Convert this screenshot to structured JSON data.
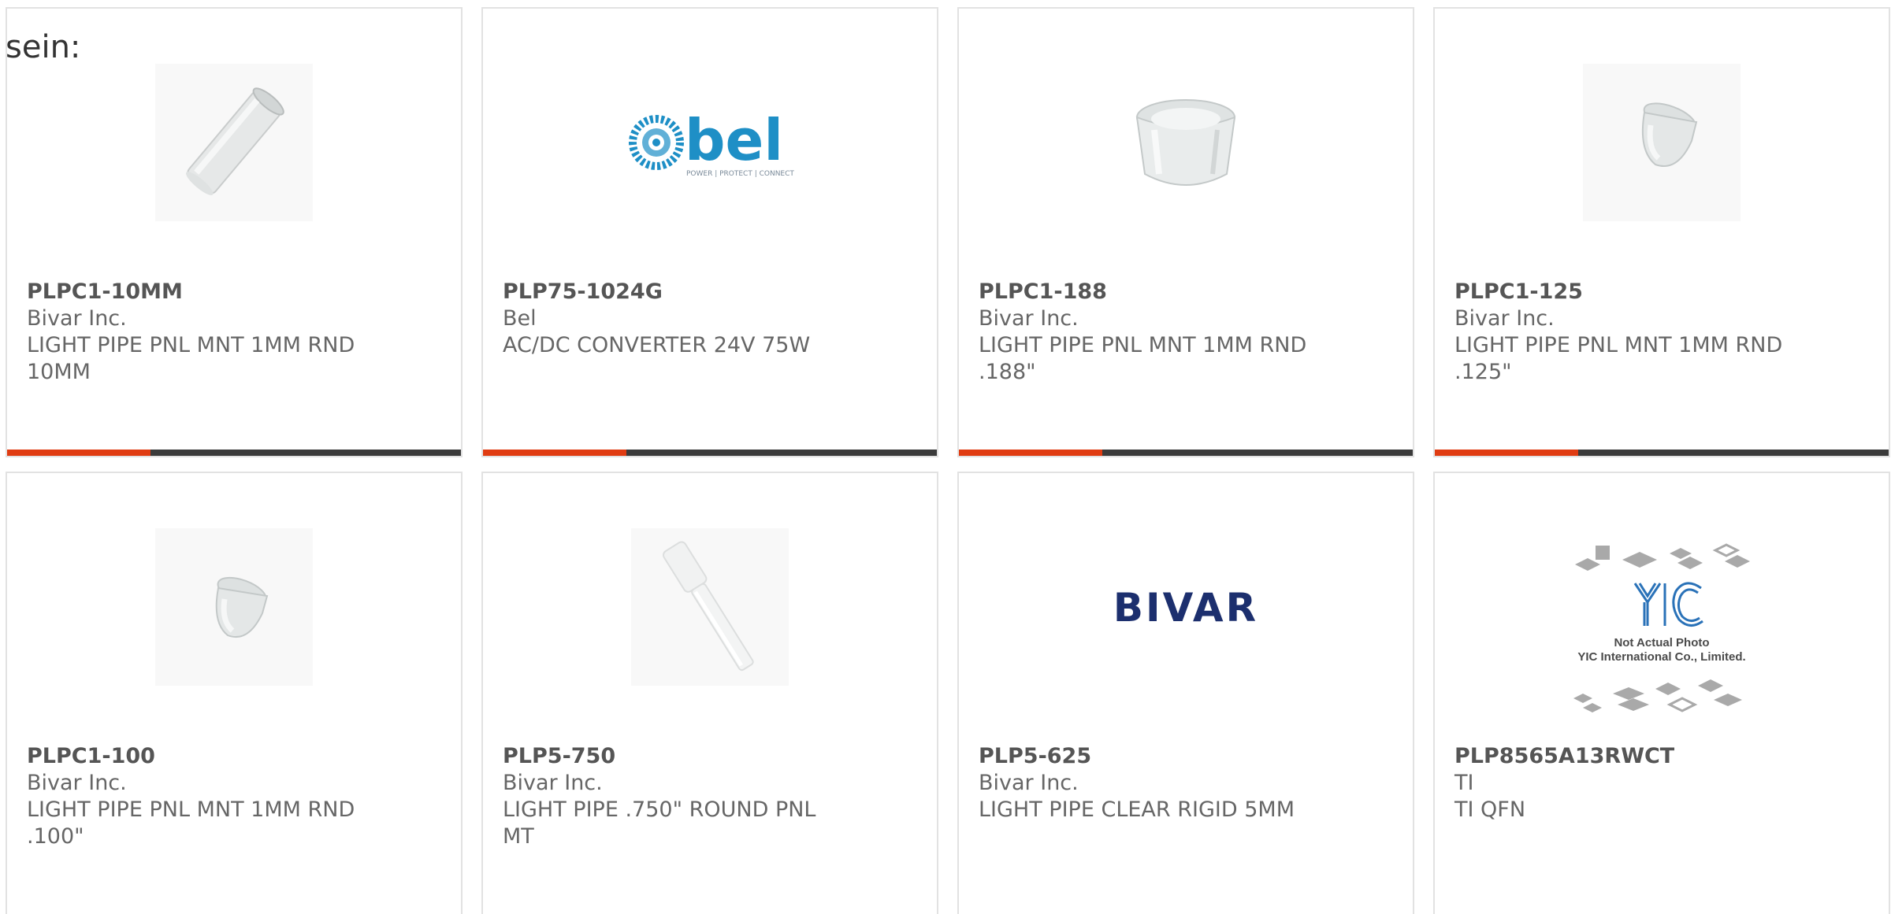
{
  "intro_text": "sein:",
  "colors": {
    "accent": "#e03c12",
    "bar_dark": "#3b3b3b",
    "card_border": "#e2e2e2",
    "bel_blue": "#1e8fc6",
    "bivar_navy": "#1c2f6e"
  },
  "products": [
    {
      "part_number": "PLPC1-10MM",
      "manufacturer": "Bivar Inc.",
      "description": "LIGHT PIPE PNL MNT 1MM RND 10MM",
      "image": "light-pipe-long-icon"
    },
    {
      "part_number": "PLP75-1024G",
      "manufacturer": "Bel",
      "description": "AC/DC CONVERTER 24V 75W",
      "image": "bel-logo",
      "logo": {
        "text": "bel",
        "tagline": "POWER | PROTECT | CONNECT"
      }
    },
    {
      "part_number": "PLPC1-188",
      "manufacturer": "Bivar Inc.",
      "description": "LIGHT PIPE PNL MNT 1MM RND .188\"",
      "image": "light-pipe-wide-icon"
    },
    {
      "part_number": "PLPC1-125",
      "manufacturer": "Bivar Inc.",
      "description": "LIGHT PIPE PNL MNT 1MM RND .125\"",
      "image": "light-pipe-small-icon"
    },
    {
      "part_number": "PLPC1-100",
      "manufacturer": "Bivar Inc.",
      "description": "LIGHT PIPE PNL MNT 1MM RND .100\"",
      "image": "light-pipe-small-icon"
    },
    {
      "part_number": "PLP5-750",
      "manufacturer": "Bivar Inc.",
      "description": "LIGHT PIPE .750\" ROUND PNL MT",
      "image": "light-pipe-rod-icon"
    },
    {
      "part_number": "PLP5-625",
      "manufacturer": "Bivar Inc.",
      "description": "LIGHT PIPE CLEAR RIGID 5MM",
      "image": "bivar-logo",
      "logo": {
        "text": "BIVAR"
      }
    },
    {
      "part_number": "PLP8565A13RWCT",
      "manufacturer": "TI",
      "description": "TI QFN",
      "image": "yic-placeholder",
      "logo": {
        "text": "YIC",
        "line1": "Not Actual Photo",
        "line2": "YIC International Co., Limited."
      }
    }
  ]
}
